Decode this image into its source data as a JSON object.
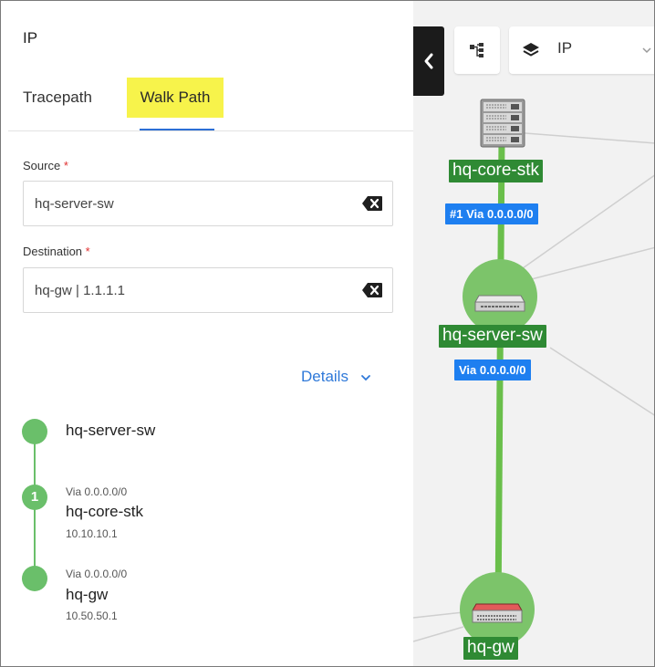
{
  "panel": {
    "title": "IP",
    "tabs": [
      {
        "label": "Tracepath"
      },
      {
        "label": "Walk Path"
      }
    ],
    "source": {
      "label": "Source",
      "required_mark": "*",
      "value": "hq-server-sw"
    },
    "destination": {
      "label": "Destination",
      "required_mark": "*",
      "value": "hq-gw | 1.1.1.1"
    },
    "details_label": "Details"
  },
  "path": {
    "start": {
      "name": "hq-server-sw"
    },
    "hops": [
      {
        "index": "1",
        "via": "Via 0.0.0.0/0",
        "name": "hq-core-stk",
        "ip": "10.10.10.1"
      },
      {
        "index": "",
        "via": "Via 0.0.0.0/0",
        "name": "hq-gw",
        "ip": "10.50.50.1"
      }
    ]
  },
  "topology": {
    "layer_select": {
      "value": "IP"
    },
    "nodes": [
      {
        "name": "hq-core-stk"
      },
      {
        "name": "hq-server-sw"
      },
      {
        "name": "hq-gw"
      }
    ],
    "badges": [
      {
        "text": "#1 Via 0.0.0.0/0"
      },
      {
        "text": "Via 0.0.0.0/0"
      }
    ],
    "colors": {
      "path": "#6abf4b",
      "node_label": "#2f8a34",
      "badge": "#1e7ff0",
      "accent": "#2f79d9",
      "highlight": "#f7f34b"
    },
    "icons": [
      "chevron-left-icon",
      "topology-tree-icon",
      "layers-icon",
      "chevron-down-icon",
      "switch-stack-icon",
      "switch-icon",
      "firewall-icon"
    ]
  }
}
